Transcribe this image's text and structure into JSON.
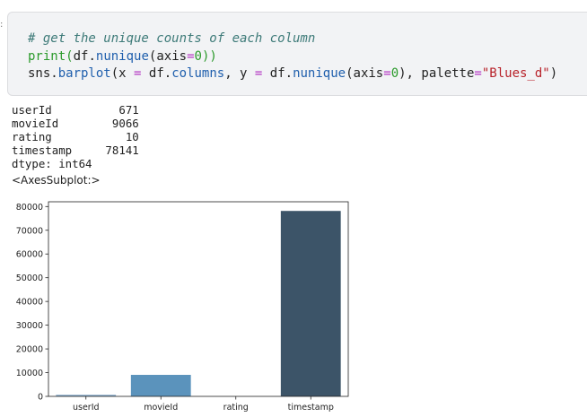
{
  "cell": {
    "prompt": ":",
    "comment": "# get the unique counts of each column",
    "line2": {
      "fn": "print",
      "open": "(",
      "obj": "df.",
      "method": "nunique",
      "args_a": "(axis",
      "eq": "=",
      "zero": "0",
      "close": "))"
    },
    "line3": {
      "obj": "sns.",
      "method": "barplot",
      "p1": "(x ",
      "eq1": "=",
      "p2": " df.",
      "attr": "columns",
      "p3": ", y ",
      "eq2": "=",
      "p4": " df.",
      "method2": "nunique",
      "p5": "(axis",
      "eq3": "=",
      "zero": "0",
      "p6": "), palette",
      "eq4": "=",
      "str": "\"Blues_d\"",
      "p7": ")"
    }
  },
  "output": {
    "rows": [
      {
        "name": "userId",
        "value": "671"
      },
      {
        "name": "movieId",
        "value": "9066"
      },
      {
        "name": "rating",
        "value": "10"
      },
      {
        "name": "timestamp",
        "value": "78141"
      }
    ],
    "dtype": "dtype: int64",
    "repr": "<AxesSubplot:>"
  },
  "chart_data": {
    "type": "bar",
    "categories": [
      "userId",
      "movieId",
      "rating",
      "timestamp"
    ],
    "values": [
      671,
      9066,
      10,
      78141
    ],
    "colors": [
      "#88abc9",
      "#5b93bc",
      "#4a77a0",
      "#3c5468"
    ],
    "yticks": [
      0,
      10000,
      20000,
      30000,
      40000,
      50000,
      60000,
      70000,
      80000
    ],
    "ylim": [
      0,
      82000
    ],
    "title": "",
    "xlabel": "",
    "ylabel": "",
    "grid": false
  }
}
